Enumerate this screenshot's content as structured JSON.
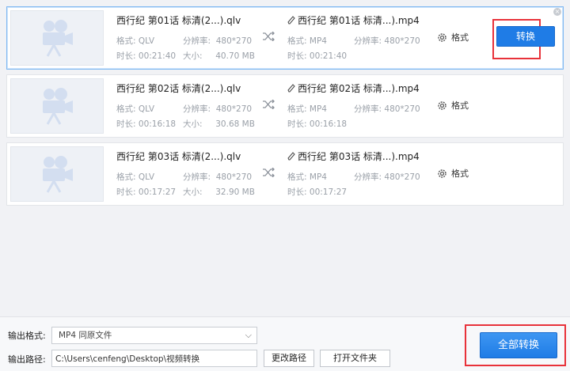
{
  "labels": {
    "format": "格式:",
    "resolution": "分辨率:",
    "duration": "时长:",
    "size": "大小:",
    "format_button": "格式",
    "convert": "转换"
  },
  "files": [
    {
      "source_name": "西行纪 第01话 标清(2...).qlv",
      "source_format": "QLV",
      "source_resolution": "480*270",
      "source_duration": "00:21:40",
      "source_size": "40.70 MB",
      "output_name": "西行纪 第01话 标清...).mp4",
      "output_format": "MP4",
      "output_resolution": "480*270",
      "output_duration": "00:21:40"
    },
    {
      "source_name": "西行纪 第02话 标清(2...).qlv",
      "source_format": "QLV",
      "source_resolution": "480*270",
      "source_duration": "00:16:18",
      "source_size": "30.68 MB",
      "output_name": "西行纪 第02话 标清...).mp4",
      "output_format": "MP4",
      "output_resolution": "480*270",
      "output_duration": "00:16:18"
    },
    {
      "source_name": "西行纪 第03话 标清(2...).qlv",
      "source_format": "QLV",
      "source_resolution": "480*270",
      "source_duration": "00:17:27",
      "source_size": "32.90 MB",
      "output_name": "西行纪 第03话 标清...).mp4",
      "output_format": "MP4",
      "output_resolution": "480*270",
      "output_duration": "00:17:27"
    }
  ],
  "footer": {
    "output_format_label": "输出格式:",
    "output_format_value": "MP4  同原文件",
    "output_path_label": "输出路径:",
    "output_path_value": "C:\\Users\\cenfeng\\Desktop\\视频转换",
    "change_path_button": "更改路径",
    "open_folder_button": "打开文件夹",
    "convert_all_button": "全部转换"
  },
  "colors": {
    "accent": "#1f7ce6",
    "highlight_box": "#e8323a",
    "selected_border": "#7fb8f2"
  }
}
